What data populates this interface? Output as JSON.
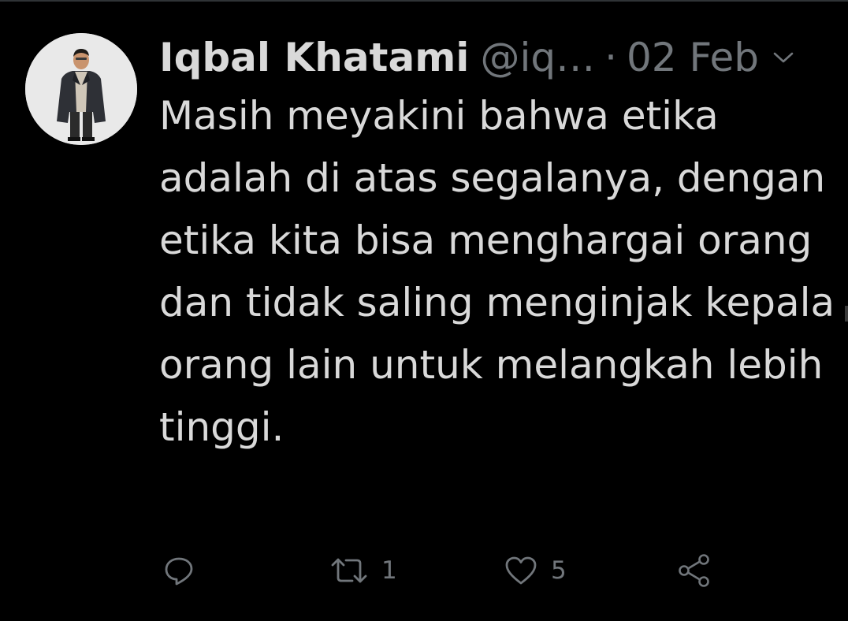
{
  "tweet": {
    "display_name": "Iqbal Khatami",
    "handle": "@iq…",
    "separator": "·",
    "date": "02 Feb",
    "text": "Masih meyakini bahwa etika adalah di atas segalanya, dengan etika kita bisa menghargai orang dan tidak saling menginjak kepala orang lain untuk melangkah lebih tinggi.",
    "avatar_icon": "person-photo-avatar",
    "menu_icon": "chevron-down-icon"
  },
  "actions": {
    "reply": {
      "icon": "reply-icon",
      "count": ""
    },
    "retweet": {
      "icon": "retweet-icon",
      "count": "1"
    },
    "like": {
      "icon": "heart-icon",
      "count": "5"
    },
    "share": {
      "icon": "share-icon",
      "count": ""
    }
  },
  "colors": {
    "background": "#000000",
    "primary_text": "#d9d9d9",
    "secondary_text": "#71767b"
  }
}
